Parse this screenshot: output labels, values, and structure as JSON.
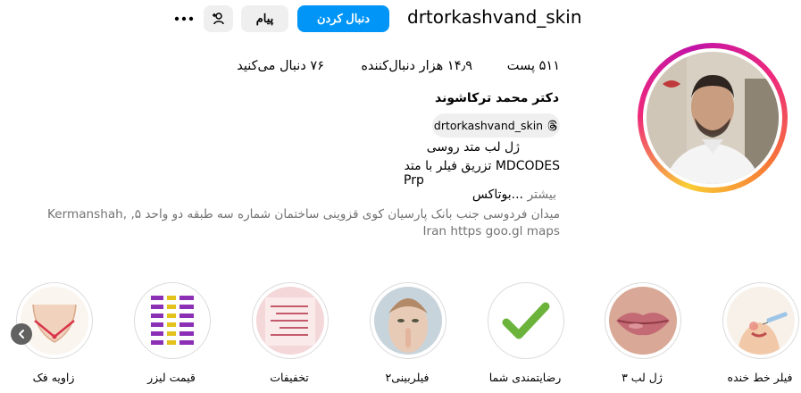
{
  "profile": {
    "username": "drtorkashvand_skin",
    "follow_label": "دنبال کردن",
    "message_label": "پیام",
    "full_name": "دکتر محمد ترکاشوند",
    "threads_handle": "drtorkashvand_skin"
  },
  "stats": {
    "posts": "۵۱۱ پست",
    "followers": "۱۴٫۹ هزار دنبال‌کننده",
    "following": "۷۶ دنبال می‌کنید"
  },
  "bio": {
    "line1": "ژل لب متد روسی",
    "line2": "MDCODES تزریق فیلر با متد",
    "line3": "Prp",
    "line4_text": "...بوتاکس",
    "line4_more": "بیشتر",
    "address": "میدان فردوسی جنب بانک پارسیان کوی قزوینی ساختمان شماره سه طبقه دو واحد ۵, Kermanshah, Iran https goo.gl maps"
  },
  "highlights": [
    {
      "label": "فیلر خط خنده",
      "icon": "filler-syringe-icon"
    },
    {
      "label": "ژل لب ۳",
      "icon": "lips-photo"
    },
    {
      "label": "رضایتمندی شما",
      "icon": "check-mark-icon"
    },
    {
      "label": "فیلربینی۲",
      "icon": "face-photo"
    },
    {
      "label": "تخفیفات",
      "icon": "discount-card-icon"
    },
    {
      "label": "قیمت لیزر",
      "icon": "price-list-icon"
    },
    {
      "label": "زاویه فک",
      "icon": "jawline-icon"
    }
  ],
  "colors": {
    "accent": "#0095f6",
    "button_gray": "#efefef",
    "secondary_text": "#737373"
  }
}
